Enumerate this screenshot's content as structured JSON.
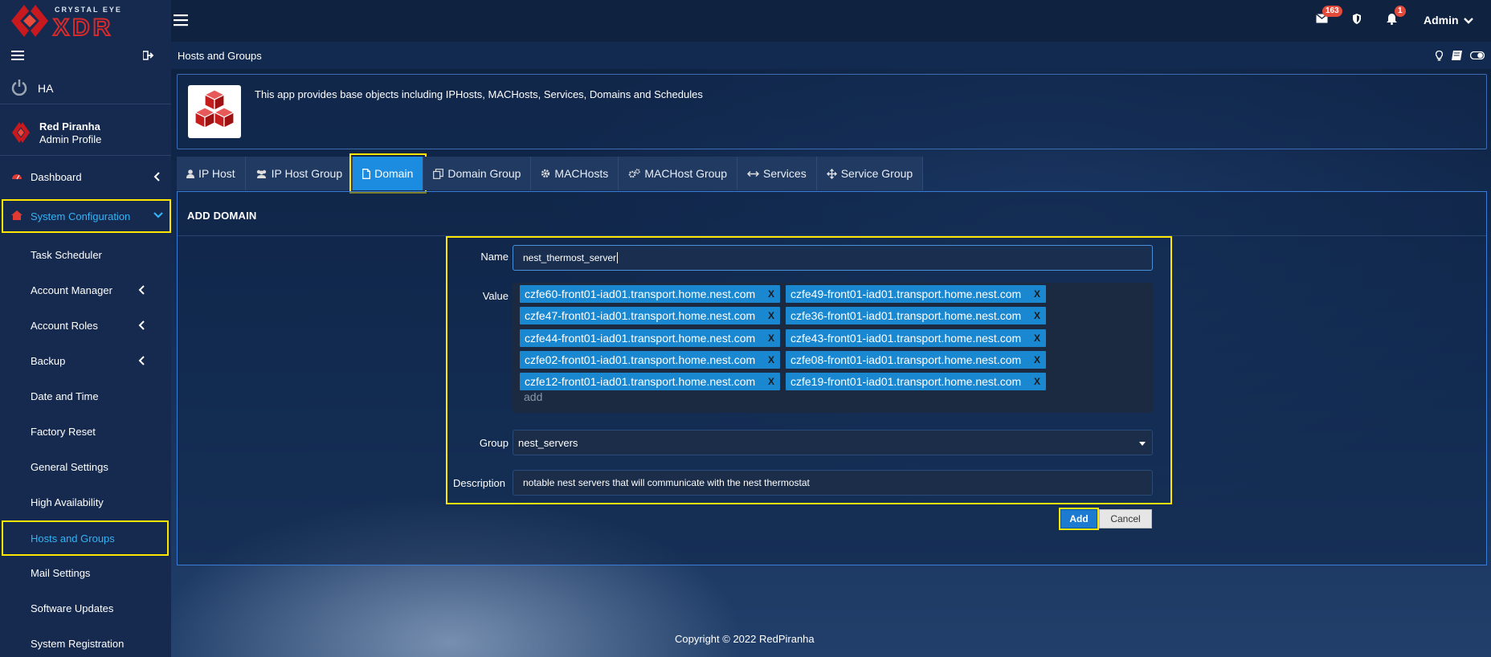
{
  "brand": {
    "line1": "CRYSTAL EYE",
    "line2": "XDR"
  },
  "topbar": {
    "mail_count": "163",
    "notif_count": "1",
    "user": "Admin"
  },
  "sidebar": {
    "ha_label": "HA",
    "profile_name": "Red Piranha",
    "profile_role": "Admin Profile",
    "dashboard": "Dashboard",
    "system_config": "System Configuration",
    "items": [
      {
        "label": "Task Scheduler"
      },
      {
        "label": "Account Manager"
      },
      {
        "label": "Account Roles"
      },
      {
        "label": "Backup"
      },
      {
        "label": "Date and Time"
      },
      {
        "label": "Factory Reset"
      },
      {
        "label": "General Settings"
      },
      {
        "label": "High Availability"
      },
      {
        "label": "Hosts and Groups"
      },
      {
        "label": "Mail Settings"
      },
      {
        "label": "Software Updates"
      },
      {
        "label": "System Registration"
      }
    ]
  },
  "page": {
    "title": "Hosts and Groups",
    "info_text": "This app provides base objects including IPHosts, MACHosts, Services, Domains and Schedules"
  },
  "tabs": [
    {
      "label": "IP Host"
    },
    {
      "label": "IP Host Group"
    },
    {
      "label": "Domain"
    },
    {
      "label": "Domain Group"
    },
    {
      "label": "MACHosts"
    },
    {
      "label": "MACHost Group"
    },
    {
      "label": "Services"
    },
    {
      "label": "Service Group"
    }
  ],
  "form": {
    "panel_title": "ADD DOMAIN",
    "name_label": "Name",
    "name_value": "nest_thermost_server",
    "value_label": "Value",
    "values": [
      "czfe60-front01-iad01.transport.home.nest.com",
      "czfe49-front01-iad01.transport.home.nest.com",
      "czfe47-front01-iad01.transport.home.nest.com",
      "czfe36-front01-iad01.transport.home.nest.com",
      "czfe44-front01-iad01.transport.home.nest.com",
      "czfe43-front01-iad01.transport.home.nest.com",
      "czfe02-front01-iad01.transport.home.nest.com",
      "czfe08-front01-iad01.transport.home.nest.com",
      "czfe12-front01-iad01.transport.home.nest.com",
      "czfe19-front01-iad01.transport.home.nest.com"
    ],
    "tag_remove": "X",
    "add_placeholder": "add",
    "group_label": "Group",
    "group_value": "nest_servers",
    "description_label": "Description",
    "description_value": "notable nest servers that will communicate with the nest thermostat",
    "add_button": "Add",
    "cancel_button": "Cancel"
  },
  "footer": "Copyright © 2022 RedPiranha"
}
